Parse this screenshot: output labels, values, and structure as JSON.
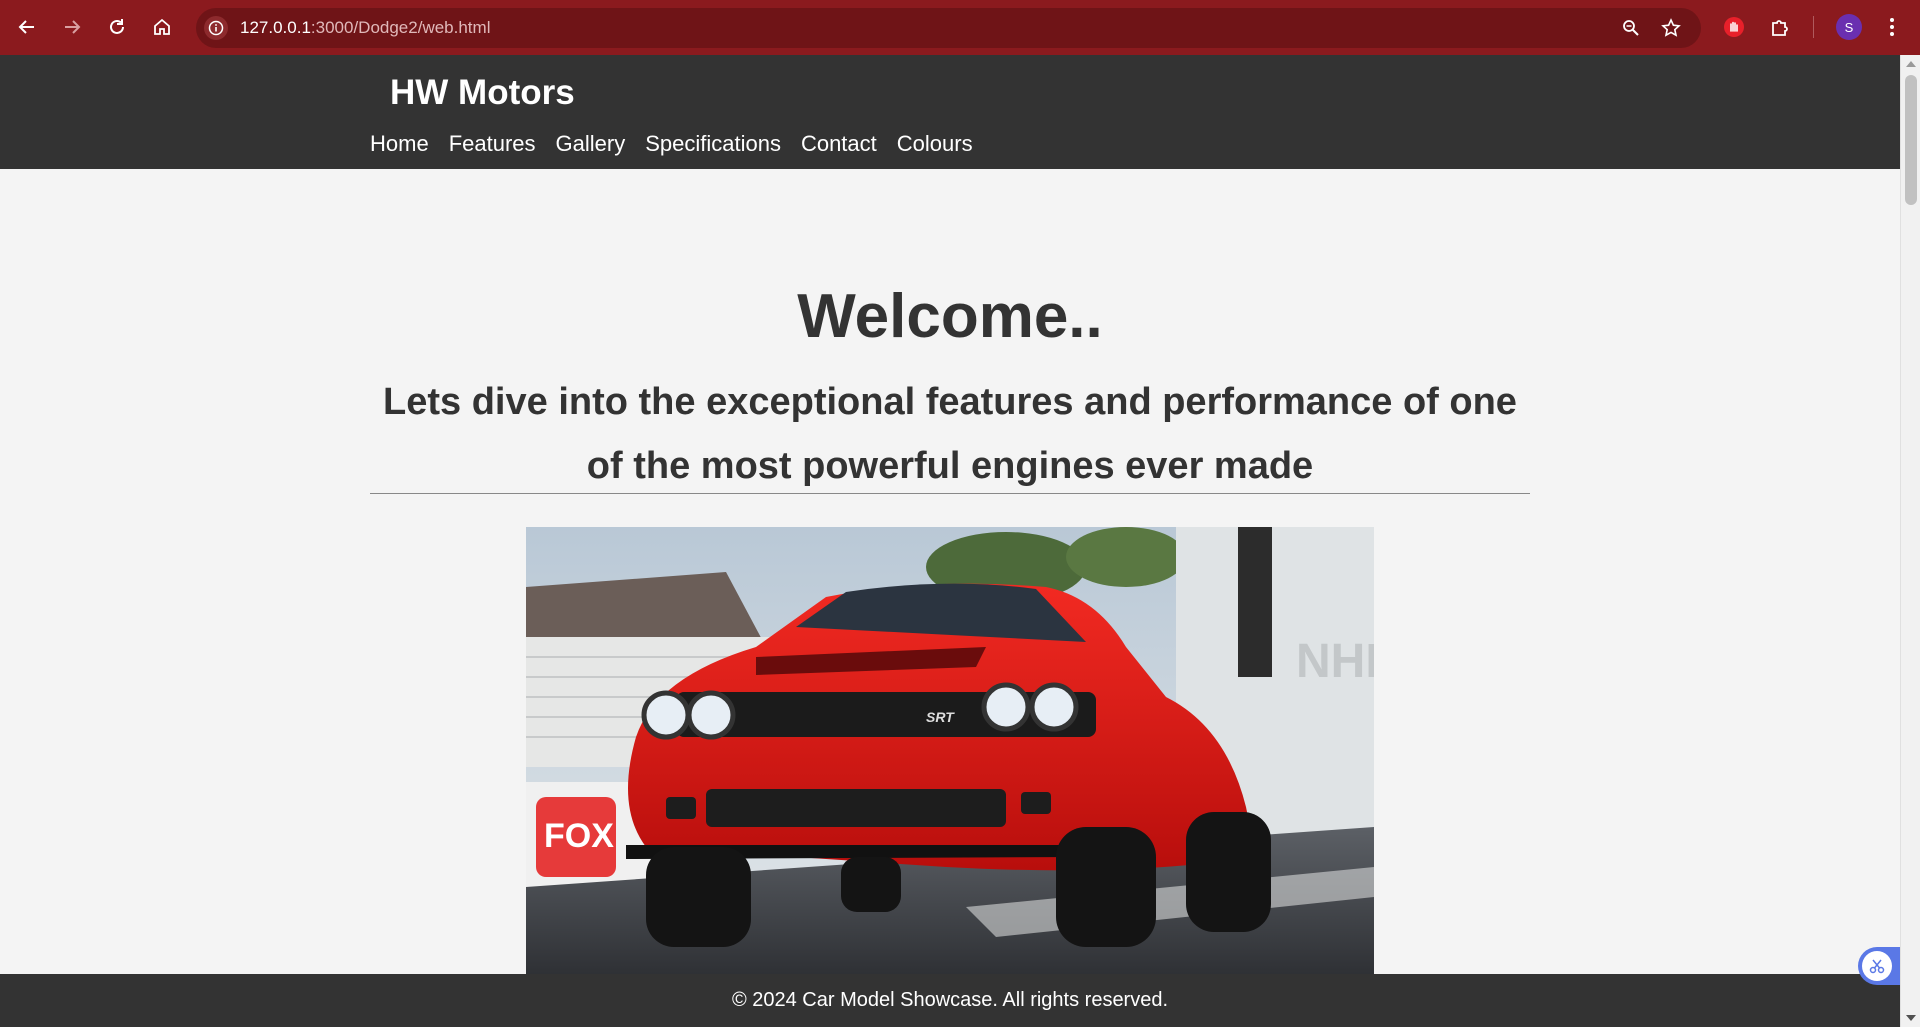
{
  "browser": {
    "url_host": "127.0.0.1",
    "url_rest": ":3000/Dodge2/web.html",
    "profile_initial": "S",
    "accent_color": "#8b1a1e",
    "icons": [
      "back-arrow-icon",
      "forward-arrow-icon",
      "reload-icon",
      "home-icon",
      "site-info-icon",
      "zoom-icon",
      "star-icon",
      "hand-extension-icon",
      "puzzle-icon",
      "kebab-menu-icon"
    ]
  },
  "site": {
    "logo": "HW Motors",
    "nav": [
      "Home",
      "Features",
      "Gallery",
      "Specifications",
      "Contact",
      "Colours"
    ],
    "welcome": "Welcome..",
    "intro": "Lets dive into the exceptional features and performance of one of the most powerful engines ever made",
    "footer": "© 2024 Car Model Showcase. All rights reserved.",
    "header_color": "#333333",
    "hero_image": "red-dodge-challenger-srt-demon-photo"
  }
}
